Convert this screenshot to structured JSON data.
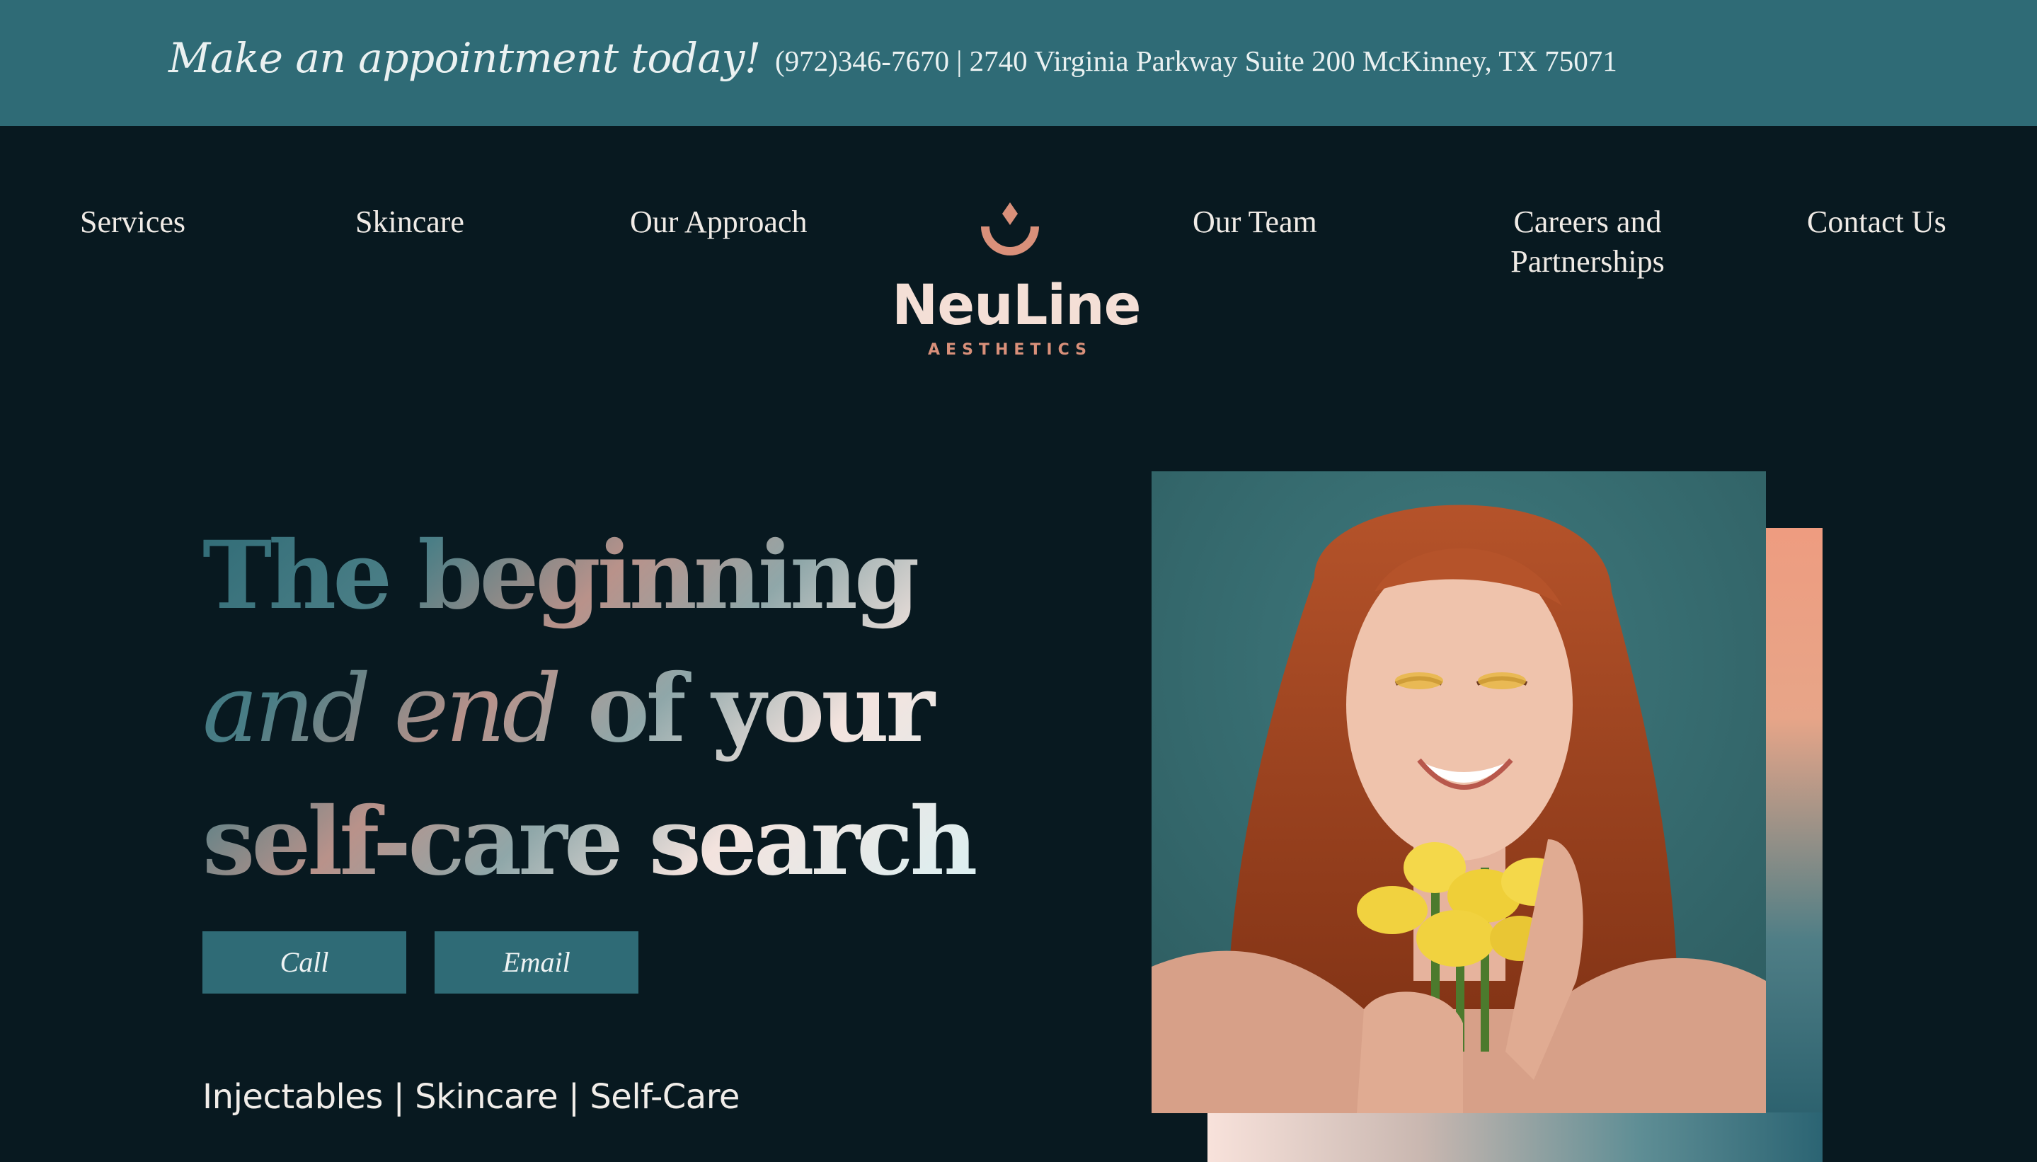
{
  "topbar": {
    "cta": "Make an appointment today!",
    "contact": "(972)346-7670 | 2740 Virginia Parkway Suite 200 McKinney, TX 75071"
  },
  "nav": {
    "services": "Services",
    "skincare": "Skincare",
    "approach": "Our Approach",
    "team": "Our Team",
    "careers": "Careers and Partnerships",
    "contact": "Contact Us"
  },
  "logo": {
    "name": "NeuLine",
    "sub": "AESTHETICS",
    "icon": "diamond-smile-icon"
  },
  "hero": {
    "line1": "The beginning",
    "line2_italic": "and end",
    "line2_rest": " of your",
    "line3": "self-care search.",
    "call_label": "Call",
    "email_label": "Email",
    "tagline": "Injectables | Skincare | Self-Care",
    "image": "woman-with-yellow-flowers-photo"
  },
  "colors": {
    "banner": "#2f6b76",
    "background": "#081920",
    "accent_peach": "#ee9c80",
    "logo_text": "#f4dfd6"
  }
}
